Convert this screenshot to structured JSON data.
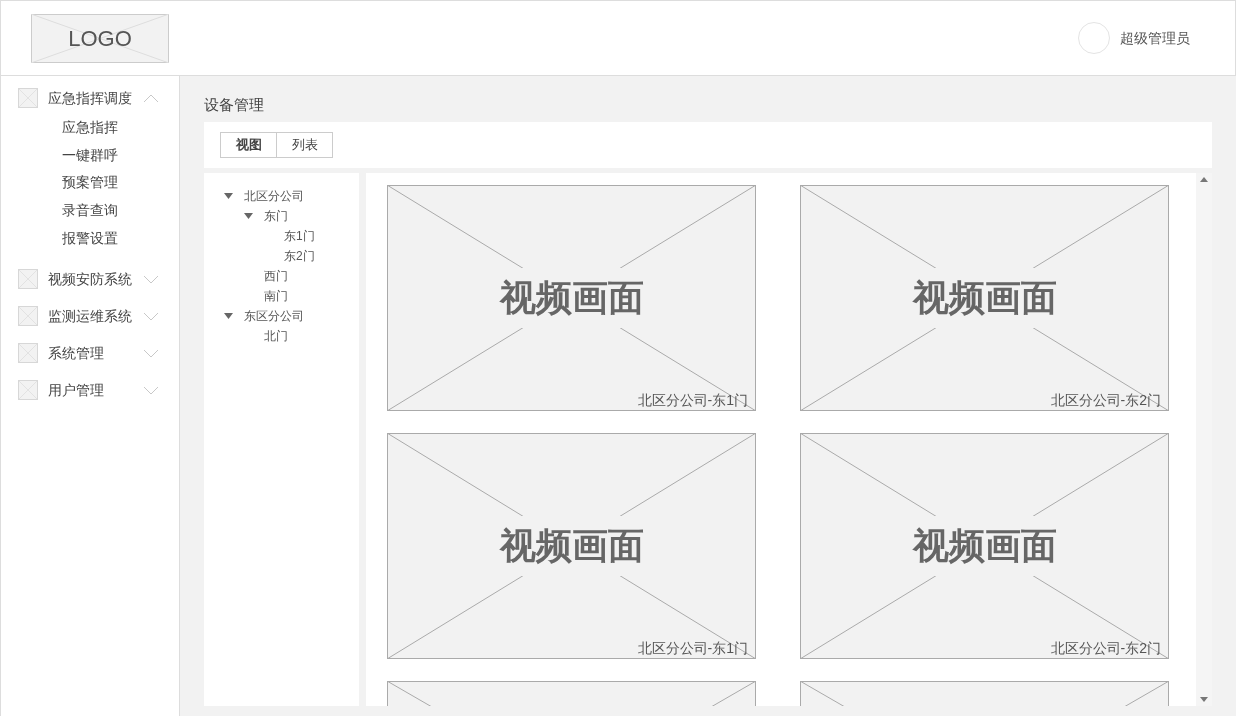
{
  "header": {
    "logo": "LOGO",
    "user": "超级管理员"
  },
  "sidebar": {
    "items": [
      {
        "label": "应急指挥调度",
        "expanded": true,
        "children": [
          {
            "label": "应急指挥"
          },
          {
            "label": "一键群呼"
          },
          {
            "label": "预案管理"
          },
          {
            "label": "录音查询"
          },
          {
            "label": "报警设置"
          }
        ]
      },
      {
        "label": "视频安防系统",
        "expanded": false
      },
      {
        "label": "监测运维系统",
        "expanded": false
      },
      {
        "label": "系统管理",
        "expanded": false
      },
      {
        "label": "用户管理",
        "expanded": false
      }
    ]
  },
  "page_title": "设备管理",
  "tabs": [
    {
      "label": "视图",
      "selected": true
    },
    {
      "label": "列表",
      "selected": false
    }
  ],
  "tree": [
    {
      "label": "北区分公司",
      "expanded": true,
      "children": [
        {
          "label": "东门",
          "expanded": true,
          "children": [
            {
              "label": "东1门"
            },
            {
              "label": "东2门"
            }
          ]
        },
        {
          "label": "西门"
        },
        {
          "label": "南门"
        }
      ]
    },
    {
      "label": "东区分公司",
      "expanded": true,
      "children": [
        {
          "label": "北门"
        }
      ]
    }
  ],
  "videos": [
    {
      "title": "视频画面",
      "caption": "北区分公司-东1门"
    },
    {
      "title": "视频画面",
      "caption": "北区分公司-东2门"
    },
    {
      "title": "视频画面",
      "caption": "北区分公司-东1门"
    },
    {
      "title": "视频画面",
      "caption": "北区分公司-东2门"
    },
    {
      "kind": "partial"
    },
    {
      "kind": "partial"
    }
  ]
}
